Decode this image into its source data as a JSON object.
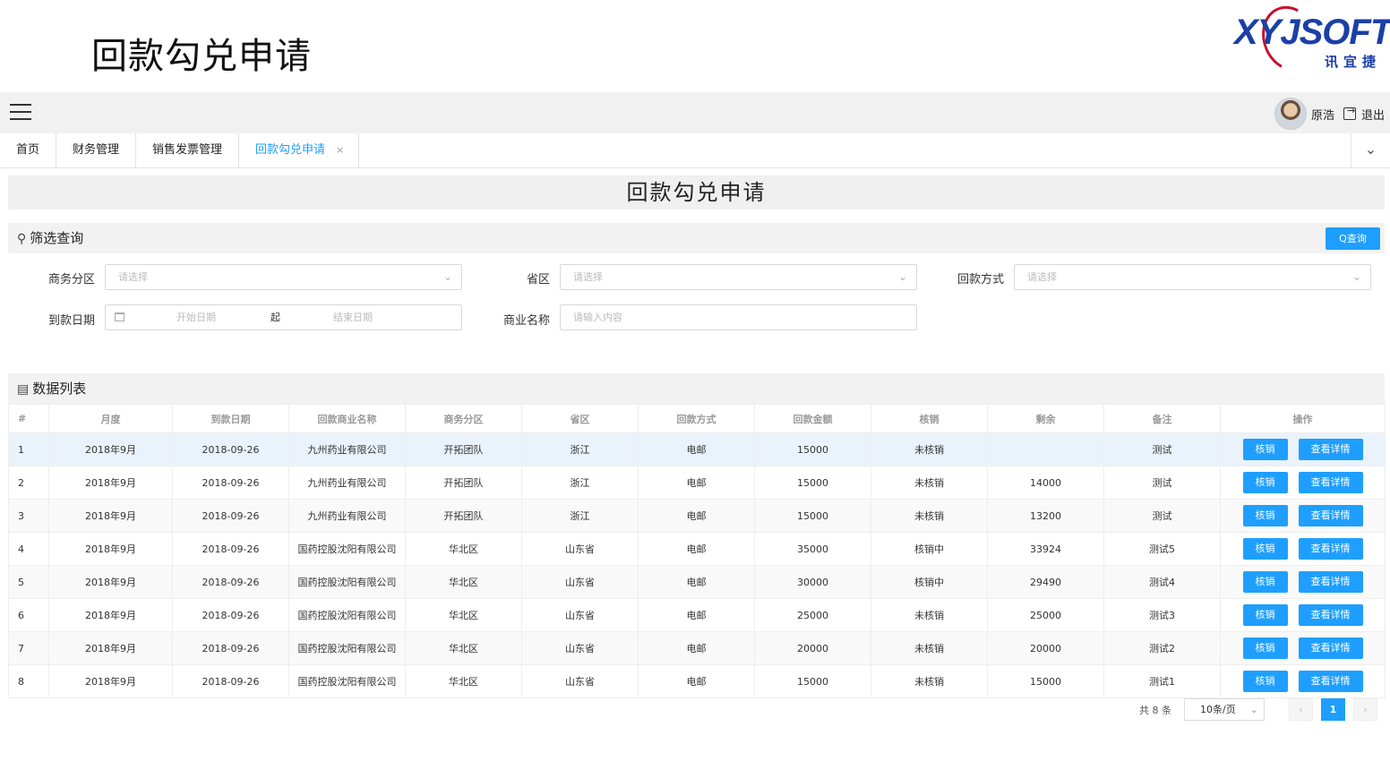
{
  "slide": {
    "title": "回款勾兑申请"
  },
  "logo": {
    "brand": "XYJSOFT",
    "sub": "讯宜捷"
  },
  "topbar": {
    "user_name": "原浩",
    "logout": "退出"
  },
  "tabs": [
    {
      "label": "首页"
    },
    {
      "label": "财务管理"
    },
    {
      "label": "销售发票管理"
    },
    {
      "label": "回款勾兑申请",
      "active": true
    }
  ],
  "tab_close": "×",
  "page": {
    "heading": "回款勾兑申请"
  },
  "filter": {
    "title": "筛选查询",
    "query_button": "Q查询",
    "business_zone_label": "商务分区",
    "business_zone_placeholder": "请选择",
    "province_label": "省区",
    "province_placeholder": "请选择",
    "payment_method_label": "回款方式",
    "payment_method_placeholder": "请选择",
    "arrival_date_label": "到款日期",
    "start_date_placeholder": "开始日期",
    "date_separator": "起",
    "end_date_placeholder": "结束日期",
    "company_label": "商业名称",
    "company_placeholder": "请输入内容"
  },
  "list": {
    "title": "数据列表",
    "columns": [
      "#",
      "月度",
      "到款日期",
      "回款商业名称",
      "商务分区",
      "省区",
      "回款方式",
      "回款金额",
      "核销",
      "剩余",
      "备注",
      "操作"
    ],
    "verify_button": "核销",
    "detail_button": "查看详情",
    "rows": [
      [
        "1",
        "2018年9月",
        "2018-09-26",
        "九州药业有限公司",
        "开拓团队",
        "浙江",
        "电邮",
        "15000",
        "未核销",
        "",
        "测试"
      ],
      [
        "2",
        "2018年9月",
        "2018-09-26",
        "九州药业有限公司",
        "开拓团队",
        "浙江",
        "电邮",
        "15000",
        "未核销",
        "14000",
        "测试"
      ],
      [
        "3",
        "2018年9月",
        "2018-09-26",
        "九州药业有限公司",
        "开拓团队",
        "浙江",
        "电邮",
        "15000",
        "未核销",
        "13200",
        "测试"
      ],
      [
        "4",
        "2018年9月",
        "2018-09-26",
        "国药控股沈阳有限公司",
        "华北区",
        "山东省",
        "电邮",
        "35000",
        "核销中",
        "33924",
        "测试5"
      ],
      [
        "5",
        "2018年9月",
        "2018-09-26",
        "国药控股沈阳有限公司",
        "华北区",
        "山东省",
        "电邮",
        "30000",
        "核销中",
        "29490",
        "测试4"
      ],
      [
        "6",
        "2018年9月",
        "2018-09-26",
        "国药控股沈阳有限公司",
        "华北区",
        "山东省",
        "电邮",
        "25000",
        "未核销",
        "25000",
        "测试3"
      ],
      [
        "7",
        "2018年9月",
        "2018-09-26",
        "国药控股沈阳有限公司",
        "华北区",
        "山东省",
        "电邮",
        "20000",
        "未核销",
        "20000",
        "测试2"
      ],
      [
        "8",
        "2018年9月",
        "2018-09-26",
        "国药控股沈阳有限公司",
        "华北区",
        "山东省",
        "电邮",
        "15000",
        "未核销",
        "15000",
        "测试1"
      ]
    ]
  },
  "pager": {
    "total": "共 8 条",
    "page_size": "10条/页",
    "prev": "‹",
    "current_page": "1",
    "next": "›"
  },
  "icons": {
    "search": "search-icon",
    "list": "list-icon",
    "calendar": "calendar-icon",
    "menu": "hamburger-icon"
  },
  "colors": {
    "primary": "#1e9fff",
    "highlight_row": "#eaf2fb"
  }
}
